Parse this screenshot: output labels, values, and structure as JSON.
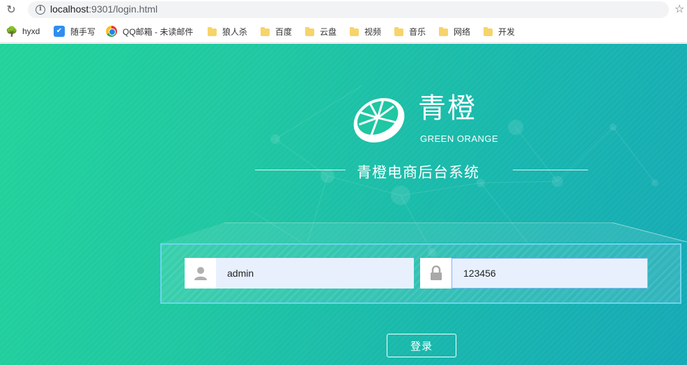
{
  "browser": {
    "url_host": "localhost",
    "url_path": ":9301/login.html",
    "bookmarks": [
      {
        "label": "hyxd",
        "icon": "tree-icon"
      },
      {
        "label": "随手写",
        "icon": "bird-icon"
      },
      {
        "label": "QQ邮箱 - 未读邮件",
        "icon": "qq-mail-icon"
      },
      {
        "label": "狼人杀",
        "icon": "folder-icon"
      },
      {
        "label": "百度",
        "icon": "folder-icon"
      },
      {
        "label": "云盘",
        "icon": "folder-icon"
      },
      {
        "label": "视频",
        "icon": "folder-icon"
      },
      {
        "label": "音乐",
        "icon": "folder-icon"
      },
      {
        "label": "网络",
        "icon": "folder-icon"
      },
      {
        "label": "开发",
        "icon": "folder-icon"
      }
    ]
  },
  "brand": {
    "name_cn": "青橙",
    "name_en": "GREEN ORANGE"
  },
  "system_title": "青橙电商后台系统",
  "login": {
    "username_value": "admin",
    "password_value": "123456",
    "submit_label": "登录"
  },
  "colors": {
    "gradient_start": "#22d39a",
    "gradient_end": "#16a9b6",
    "input_bg": "#e8f0fe"
  }
}
